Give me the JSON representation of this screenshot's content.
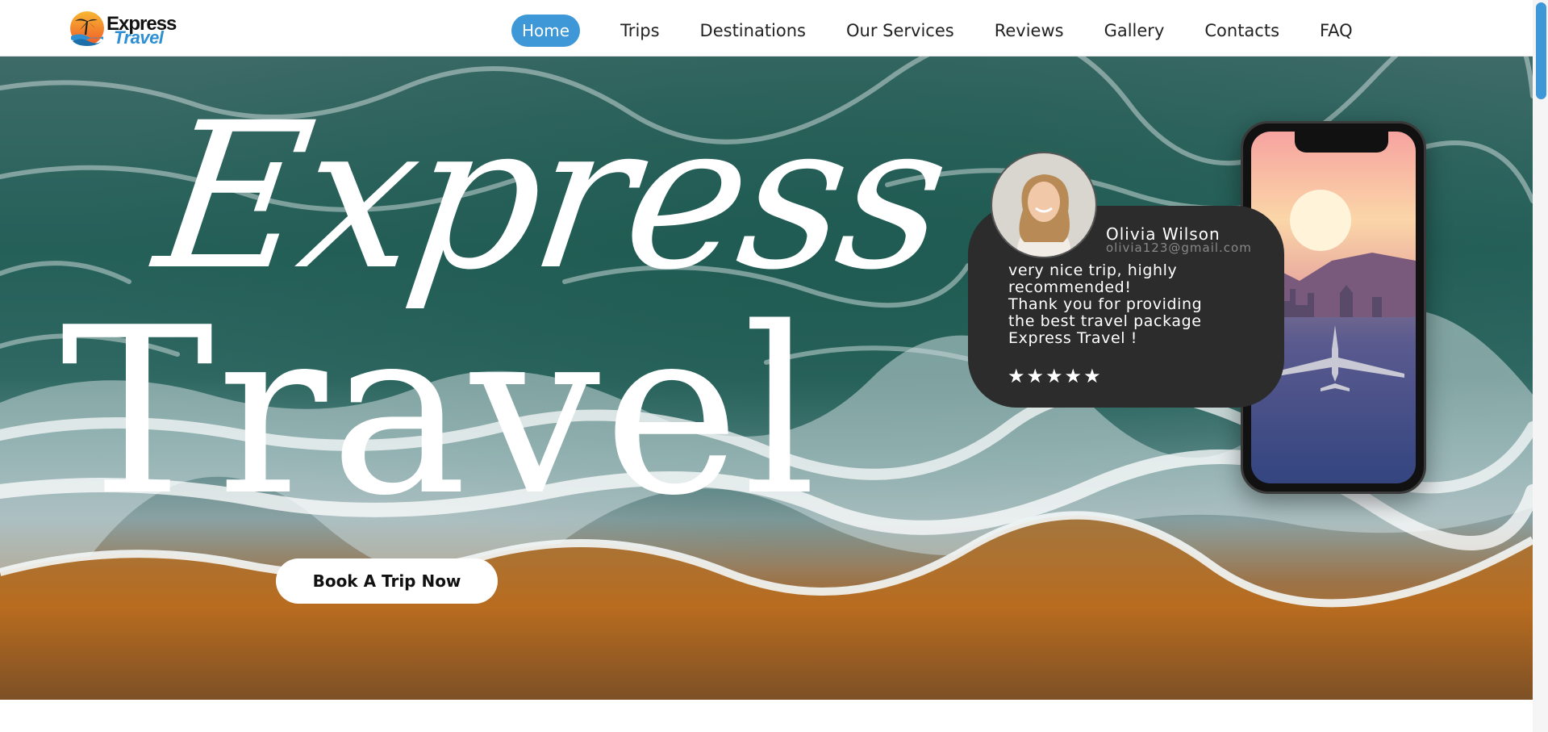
{
  "brand": {
    "line1": "Express",
    "line2": "Travel"
  },
  "nav": {
    "items": [
      {
        "label": "Home",
        "active": true
      },
      {
        "label": "Trips"
      },
      {
        "label": "Destinations"
      },
      {
        "label": "Our Services"
      },
      {
        "label": "Reviews"
      },
      {
        "label": "Gallery"
      },
      {
        "label": "Contacts"
      },
      {
        "label": "FAQ"
      }
    ]
  },
  "hero": {
    "title_script": "Express",
    "title_main": "Travel",
    "cta_label": "Book A Trip Now"
  },
  "review": {
    "name": "Olivia Wilson",
    "email": "olivia123@gmail.com",
    "text": "very nice trip, highly\nrecommended!\nThank you for providing\nthe best travel package\nExpress Travel !",
    "rating": 5,
    "star_glyph": "★"
  },
  "colors": {
    "accent": "#3e97d6",
    "card": "#2c2c2c",
    "brand_blue": "#2e8fd3"
  }
}
